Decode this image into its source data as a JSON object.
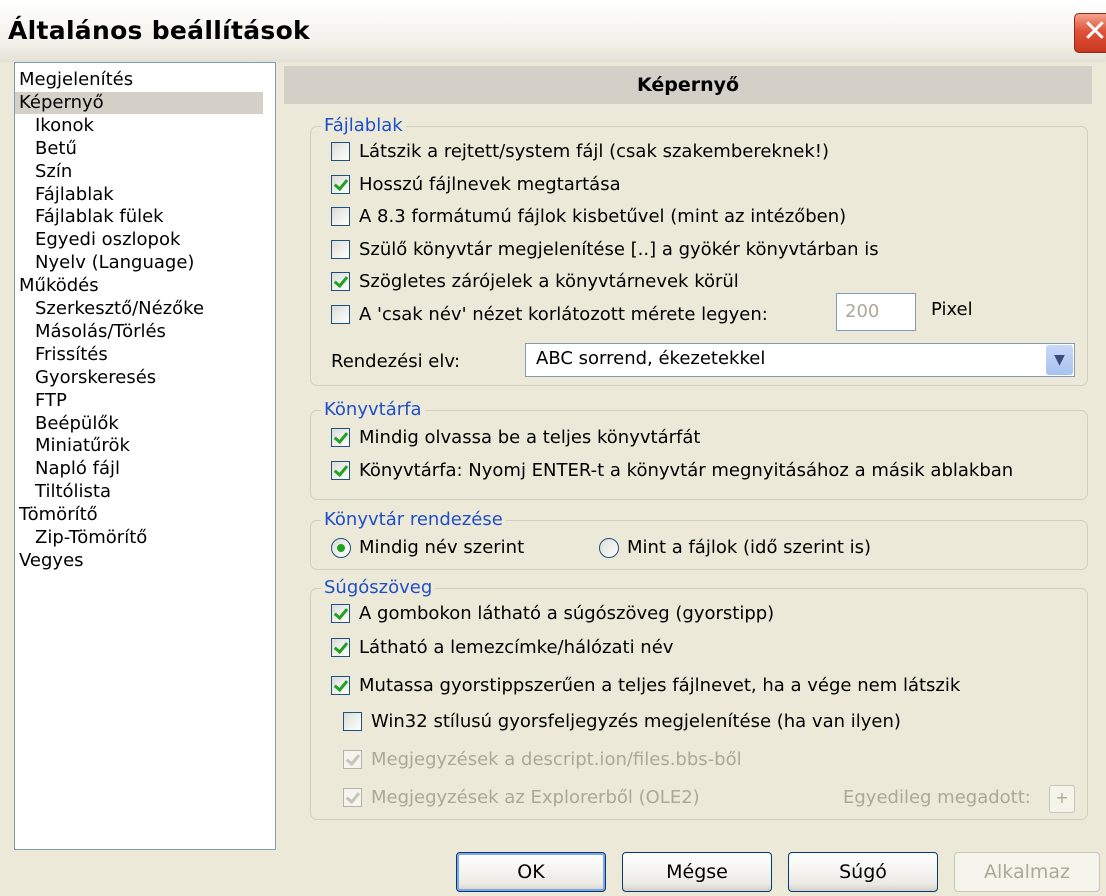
{
  "window": {
    "title": "Általános beállítások",
    "close_symbol": "✕"
  },
  "sidebar": {
    "items": [
      {
        "label": "Megjelenítés",
        "level": 0
      },
      {
        "label": "Képernyő",
        "level": 0,
        "selected": true
      },
      {
        "label": "Ikonok",
        "level": 1
      },
      {
        "label": "Betű",
        "level": 1
      },
      {
        "label": "Szín",
        "level": 1
      },
      {
        "label": "Fájlablak",
        "level": 1
      },
      {
        "label": "Fájlablak fülek",
        "level": 1
      },
      {
        "label": "Egyedi oszlopok",
        "level": 1
      },
      {
        "label": "Nyelv (Language)",
        "level": 1
      },
      {
        "label": "Működés",
        "level": 0
      },
      {
        "label": "Szerkesztő/Nézőke",
        "level": 1
      },
      {
        "label": "Másolás/Törlés",
        "level": 1
      },
      {
        "label": "Frissítés",
        "level": 1
      },
      {
        "label": "Gyorskeresés",
        "level": 1
      },
      {
        "label": "FTP",
        "level": 1
      },
      {
        "label": "Beépülők",
        "level": 1
      },
      {
        "label": "Miniatűrök",
        "level": 1
      },
      {
        "label": "Napló fájl",
        "level": 1
      },
      {
        "label": "Tiltólista",
        "level": 1
      },
      {
        "label": "Tömörítő",
        "level": 0
      },
      {
        "label": "Zip-Tömörítő",
        "level": 1
      },
      {
        "label": "Vegyes",
        "level": 0
      }
    ]
  },
  "panel": {
    "header": "Képernyő",
    "fajlablak": {
      "legend": "Fájlablak",
      "options": [
        {
          "label": "Látszik a rejtett/system fájl (csak szakembereknek!)",
          "checked": false
        },
        {
          "label": "Hosszú fájlnevek megtartása",
          "checked": true
        },
        {
          "label": "A 8.3 formátumú fájlok kisbetűvel (mint az intézőben)",
          "checked": false
        },
        {
          "label": "Szülő könyvtár megjelenítése [..] a gyökér könyvtárban is",
          "checked": false
        },
        {
          "label": "Szögletes zárójelek a könyvtárnevek körül",
          "checked": true
        },
        {
          "label": "A 'csak név' nézet korlátozott mérete legyen:",
          "checked": false
        }
      ],
      "size_value": "200",
      "size_unit": "Pixel",
      "sort_label": "Rendezési elv:",
      "sort_value": "ABC sorrend, ékezetekkel"
    },
    "konyvtarfa": {
      "legend": "Könyvtárfa",
      "options": [
        {
          "label": "Mindig olvassa be a teljes könyvtárfát",
          "checked": true
        },
        {
          "label": "Könyvtárfa: Nyomj ENTER-t a könyvtár megnyitásához a másik ablakban",
          "checked": true
        }
      ]
    },
    "rendezes": {
      "legend": "Könyvtár rendezése",
      "options": [
        {
          "label": "Mindig név szerint",
          "checked": true
        },
        {
          "label": "Mint a fájlok (idő szerint is)",
          "checked": false
        }
      ]
    },
    "sugo": {
      "legend": "Súgószöveg",
      "options": [
        {
          "label": "A gombokon látható a súgószöveg (gyorstipp)",
          "checked": true,
          "disabled": false
        },
        {
          "label": "Látható a lemezcímke/hálózati név",
          "checked": true,
          "disabled": false
        },
        {
          "label": "Mutassa gyorstippszerűen a teljes fájlnevet, ha a vége nem látszik",
          "checked": true,
          "disabled": false
        },
        {
          "label": "Win32 stílusú gyorsfeljegyzés megjelenítése (ha van ilyen)",
          "checked": false,
          "disabled": false
        },
        {
          "label": "Megjegyzések a descript.ion/files.bbs-ből",
          "checked": true,
          "disabled": true
        },
        {
          "label": "Megjegyzések az Explorerből (OLE2)",
          "checked": true,
          "disabled": true
        }
      ],
      "custom_label": "Egyedileg megadott:",
      "custom_button": "+"
    }
  },
  "buttons": {
    "ok": "OK",
    "cancel": "Mégse",
    "help": "Súgó",
    "apply": "Alkalmaz"
  }
}
